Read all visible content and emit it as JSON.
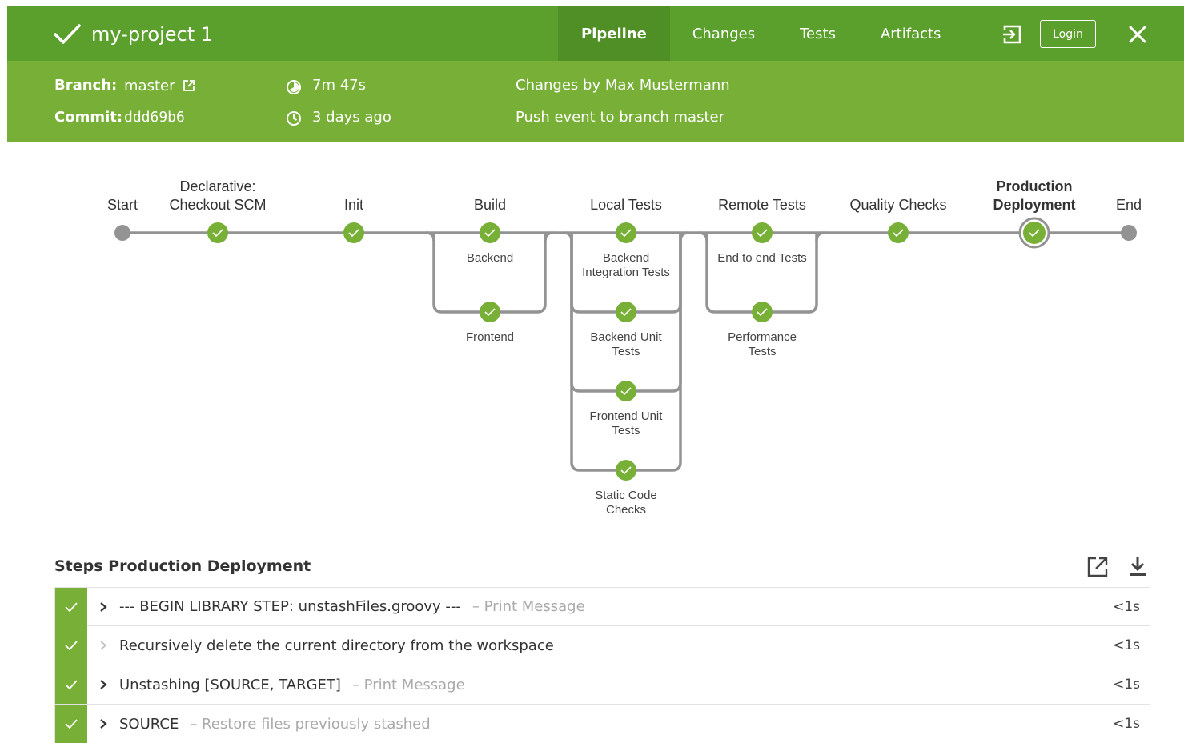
{
  "run": {
    "title": "my-project 1",
    "status_icon": "check-icon"
  },
  "tabs": [
    {
      "label": "Pipeline",
      "active": true
    },
    {
      "label": "Changes"
    },
    {
      "label": "Tests"
    },
    {
      "label": "Artifacts"
    }
  ],
  "header_actions": {
    "login_label": "Login"
  },
  "meta": {
    "branch_label": "Branch:",
    "branch_value": "master",
    "commit_label": "Commit:",
    "commit_value": "ddd69b6",
    "duration": "7m 47s",
    "time_ago": "3 days ago",
    "changes_by": "Changes by Max Mustermann",
    "cause": "Push event to branch master"
  },
  "colors": {
    "header": "#78b037",
    "topbar": "#5ba02d",
    "success": "#78b037"
  },
  "pipeline": {
    "stages": [
      {
        "id": "start",
        "label": "Start",
        "label2": ""
      },
      {
        "id": "checkout",
        "label": "Declarative:",
        "label2": "Checkout SCM"
      },
      {
        "id": "init",
        "label": "Init",
        "label2": ""
      },
      {
        "id": "build",
        "label": "Build",
        "label2": ""
      },
      {
        "id": "local",
        "label": "Local Tests",
        "label2": ""
      },
      {
        "id": "remote",
        "label": "Remote Tests",
        "label2": ""
      },
      {
        "id": "quality",
        "label": "Quality Checks",
        "label2": ""
      },
      {
        "id": "prod",
        "label": "Production",
        "label2": "Deployment",
        "selected": true
      },
      {
        "id": "end",
        "label": "End",
        "label2": ""
      }
    ],
    "branches": {
      "build": [
        [
          "Backend"
        ],
        [
          "Frontend"
        ]
      ],
      "local": [
        [
          "Backend",
          "Integration Tests"
        ],
        [
          "Backend Unit",
          "Tests"
        ],
        [
          "Frontend Unit",
          "Tests"
        ],
        [
          "Static Code",
          "Checks"
        ]
      ],
      "remote": [
        [
          "End to end Tests"
        ],
        [
          "Performance",
          "Tests"
        ]
      ]
    }
  },
  "steps": {
    "title": "Steps Production Deployment",
    "items": [
      {
        "text": "--- BEGIN LIBRARY STEP: unstashFiles.groovy ---",
        "desc": "– Print Message",
        "duration": "<1s",
        "expandable": true
      },
      {
        "text": "Recursively delete the current directory from the workspace",
        "desc": "",
        "duration": "<1s",
        "expandable": false
      },
      {
        "text": "Unstashing [SOURCE, TARGET]",
        "desc": "– Print Message",
        "duration": "<1s",
        "expandable": true
      },
      {
        "text": "SOURCE",
        "desc": "– Restore files previously stashed",
        "duration": "<1s",
        "expandable": true
      }
    ]
  }
}
